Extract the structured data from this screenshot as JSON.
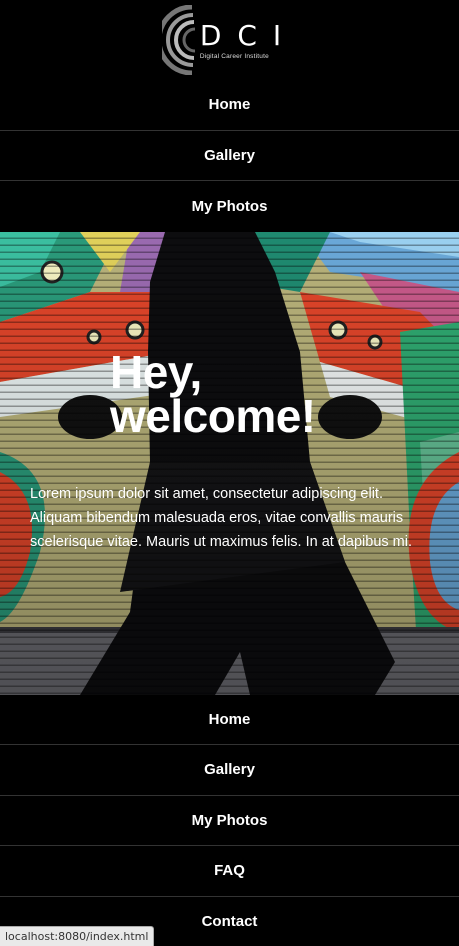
{
  "logo": {
    "letters": "DCI",
    "subtitle": "Digital Career Institute"
  },
  "top_nav": {
    "items": [
      {
        "label": "Home"
      },
      {
        "label": "Gallery"
      },
      {
        "label": "My Photos"
      }
    ]
  },
  "hero": {
    "title_line1": "Hey,",
    "title_line2": "welcome!",
    "text": "Lorem ipsum dolor sit amet, consectetur adipiscing elit. Aliquam bibendum malesuada eros, vitae convallis mauris scelerisque vitae. Mauris ut maximus felis. In at dapibus mi."
  },
  "footer_nav": {
    "items": [
      {
        "label": "Home"
      },
      {
        "label": "Gallery"
      },
      {
        "label": "My Photos"
      },
      {
        "label": "FAQ"
      },
      {
        "label": "Contact"
      }
    ]
  },
  "status_bar": {
    "url": "localhost:8080/index.html"
  },
  "colors": {
    "background": "#000000",
    "nav_divider": "#333333",
    "text": "#ffffff"
  }
}
